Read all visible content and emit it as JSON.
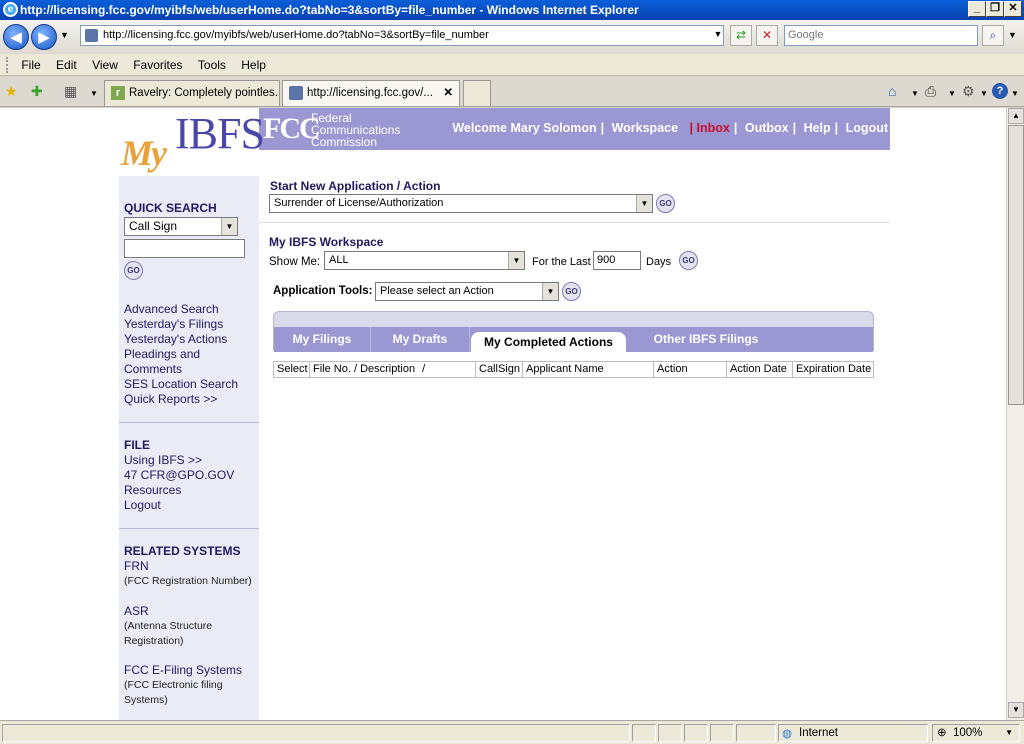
{
  "window": {
    "title": "http://licensing.fcc.gov/myibfs/web/userHome.do?tabNo=3&sortBy=file_number - Windows Internet Explorer"
  },
  "address": {
    "url": "http://licensing.fcc.gov/myibfs/web/userHome.do?tabNo=3&sortBy=file_number",
    "search_placeholder": "Google"
  },
  "menu": [
    "File",
    "Edit",
    "View",
    "Favorites",
    "Tools",
    "Help"
  ],
  "browser_tabs": [
    {
      "label": "Ravelry: Completely pointles..."
    },
    {
      "label": "http://licensing.fcc.gov/..."
    }
  ],
  "status": {
    "zone": "Internet",
    "zoom": "100%"
  },
  "banner": {
    "fcc_mark": "FCC",
    "fcc_name_1": "Federal",
    "fcc_name_2": "Communications",
    "fcc_name_3": "Commission",
    "welcome": "Welcome Mary Solomon",
    "workspace": "Workspace",
    "inbox": "Inbox",
    "outbox": "Outbox",
    "help": "Help",
    "logout": "Logout"
  },
  "logo": {
    "my": "My",
    "ibfs": "IBFS"
  },
  "sidebar": {
    "quick_search": "QUICK SEARCH",
    "search_type": "Call Sign",
    "go": "GO",
    "links": [
      "Advanced Search",
      "Yesterday's Filings",
      "Yesterday's Actions",
      "Pleadings and",
      "Comments",
      "SES Location Search",
      "Quick Reports >>"
    ],
    "file_head": "FILE",
    "file_links": [
      "Using IBFS >>",
      "47 CFR@GPO.GOV",
      "Resources",
      "Logout"
    ],
    "related_head": "RELATED SYSTEMS",
    "frn": "FRN",
    "frn_note": "(FCC Registration Number)",
    "asr": "ASR",
    "asr_note_1": "(Antenna Structure",
    "asr_note_2": "Registration)",
    "efiling": "FCC E-Filing Systems",
    "efiling_note_1": "(FCC Electronic filing",
    "efiling_note_2": "Systems)"
  },
  "main": {
    "start_head": "Start New Application / Action",
    "start_value": "Surrender of License/Authorization",
    "workspace_head": "My IBFS Workspace",
    "show_me_label": "Show Me:",
    "show_me_value": "ALL",
    "for_last_label": "For the Last",
    "days_value": "900",
    "days_label": "Days",
    "app_tools_label": "Application Tools:",
    "app_tools_value": "Please select an Action",
    "go": "GO"
  },
  "tabs": [
    "My Filings",
    "My Drafts",
    "My Completed Actions",
    "Other IBFS Filings"
  ],
  "table_headers": [
    "Select",
    "File No. / Description",
    "CallSign",
    "Applicant Name",
    "Action",
    "Action Date",
    "Expiration Date"
  ],
  "sort_glyph": "/"
}
